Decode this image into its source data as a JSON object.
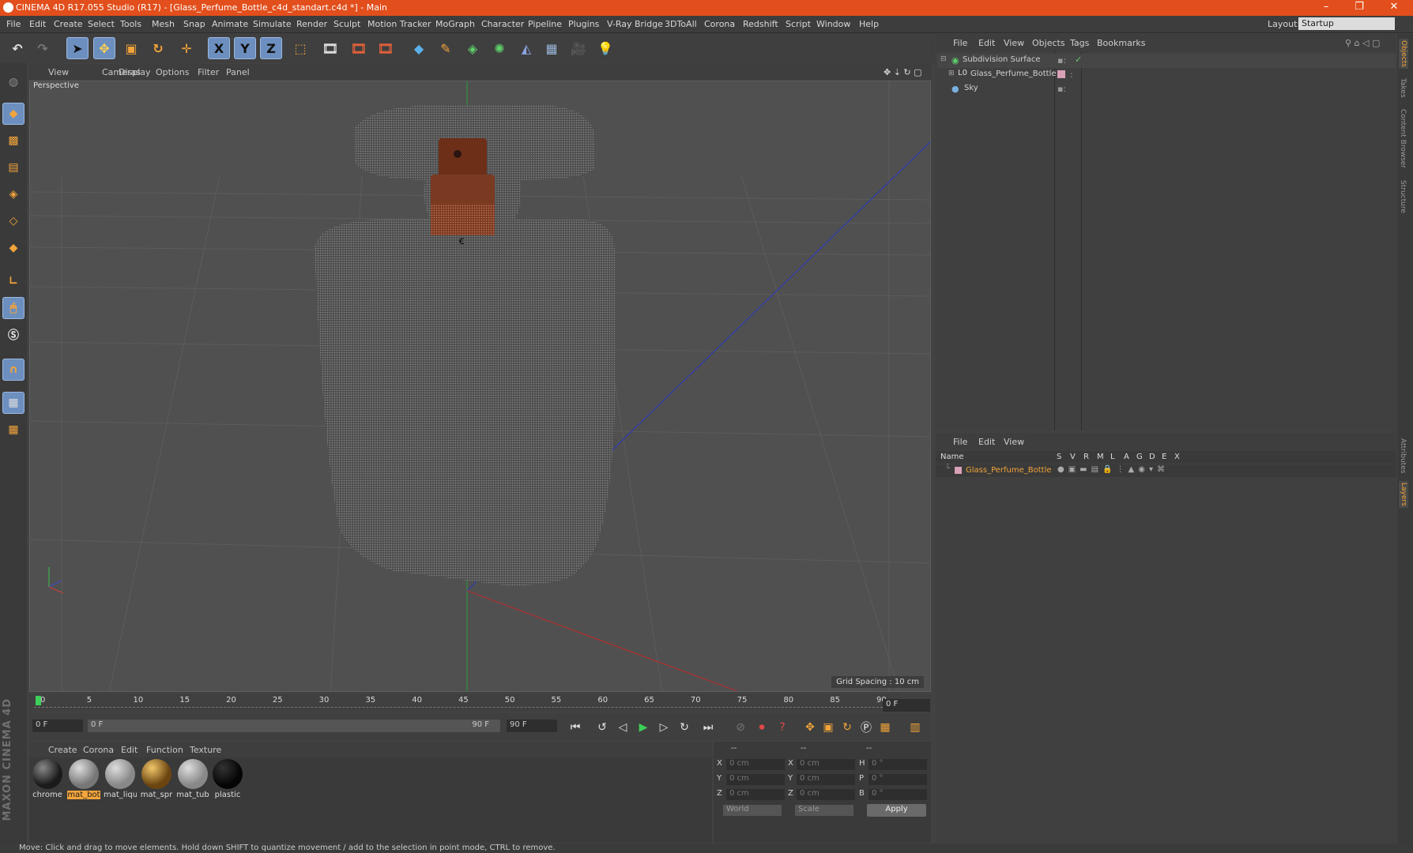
{
  "window": {
    "title": "CINEMA 4D R17.055 Studio (R17) - [Glass_Perfume_Bottle_c4d_standart.c4d *] - Main",
    "controls": {
      "minimize": "–",
      "restore": "❐",
      "close": "✕"
    }
  },
  "menubar": {
    "items": [
      "File",
      "Edit",
      "Create",
      "Select",
      "Tools",
      "Mesh",
      "Snap",
      "Animate",
      "Simulate",
      "Render",
      "Sculpt",
      "Motion Tracker",
      "MoGraph",
      "Character",
      "Pipeline",
      "Plugins",
      "V-Ray Bridge",
      "3DToAll",
      "Corona",
      "Redshift",
      "Script",
      "Window",
      "Help"
    ],
    "layout_label": "Layout:",
    "layout_value": "Startup"
  },
  "toolbar": {
    "icons": [
      "undo-icon",
      "redo-icon",
      "select-arrow-icon",
      "move-icon",
      "scale-icon",
      "rotate-icon",
      "move-all-icon",
      "axis-x-icon",
      "axis-y-icon",
      "axis-z-icon",
      "world-coord-icon",
      "render-view-icon",
      "render-picture-viewer-icon",
      "render-settings-icon",
      "cube-primitive-icon",
      "pen-spline-icon",
      "subdivision-icon",
      "cloner-icon",
      "deformer-icon",
      "floor-icon",
      "camera-icon",
      "light-icon"
    ],
    "axis_x": "X",
    "axis_y": "Y",
    "axis_z": "Z"
  },
  "viewport": {
    "menu": [
      "View",
      "Cameras",
      "Display",
      "Options",
      "Filter",
      "Panel"
    ],
    "label": "Perspective",
    "grid_spacing": "Grid Spacing : 10 cm"
  },
  "timeline": {
    "ticks": [
      "0",
      "5",
      "10",
      "15",
      "20",
      "25",
      "30",
      "35",
      "40",
      "45",
      "50",
      "55",
      "60",
      "65",
      "70",
      "75",
      "80",
      "85",
      "90"
    ],
    "current_frame_field": "0 F",
    "start_field": "0 F",
    "range_start": "0 F",
    "range_end": "90 F",
    "end_field": "90 F"
  },
  "materials": {
    "menu": [
      "Create",
      "Corona",
      "Edit",
      "Function",
      "Texture"
    ],
    "items": [
      {
        "name": "chrome",
        "color": "#1a1a1a"
      },
      {
        "name": "mat_bot",
        "color": "#8a8a8a",
        "selected": true
      },
      {
        "name": "mat_liqu",
        "color": "#9a9a9a"
      },
      {
        "name": "mat_spr",
        "color": "#8a5a1a"
      },
      {
        "name": "mat_tub",
        "color": "#9a9a9a"
      },
      {
        "name": "plastic",
        "color": "#0d0d0d"
      }
    ]
  },
  "coordinates": {
    "headers": [
      "--",
      "--",
      "--"
    ],
    "rows": [
      {
        "a": "X",
        "av": "0 cm",
        "b": "X",
        "bv": "0 cm",
        "c": "H",
        "cv": "0 °"
      },
      {
        "a": "Y",
        "av": "0 cm",
        "b": "Y",
        "bv": "0 cm",
        "c": "P",
        "cv": "0 °"
      },
      {
        "a": "Z",
        "av": "0 cm",
        "b": "Z",
        "bv": "0 cm",
        "c": "B",
        "cv": "0 °"
      }
    ],
    "mode1": "World",
    "mode2": "Scale",
    "apply": "Apply"
  },
  "object_manager": {
    "menu": [
      "File",
      "Edit",
      "View",
      "Objects",
      "Tags",
      "Bookmarks"
    ],
    "objects": [
      {
        "name": "Subdivision Surface",
        "icon": "subdivision-icon"
      },
      {
        "name": "Glass_Perfume_Bottle",
        "icon": "null-object-icon"
      },
      {
        "name": "Sky",
        "icon": "sky-icon"
      }
    ]
  },
  "layer_manager": {
    "menu": [
      "File",
      "Edit",
      "View"
    ],
    "columns": [
      "Name",
      "S",
      "V",
      "R",
      "M",
      "L",
      "A",
      "G",
      "D",
      "E",
      "X"
    ],
    "layers": [
      {
        "name": "Glass_Perfume_Bottle",
        "color": "#d9a0b8"
      }
    ]
  },
  "right_tabs": [
    "Objects",
    "Takes",
    "Content Browser",
    "Structure",
    "Attributes",
    "Layers"
  ],
  "status": "Move: Click and drag to move elements. Hold down SHIFT to quantize movement / add to the selection in point mode, CTRL to remove.",
  "brand": "MAXON CINEMA 4D",
  "colors": {
    "accent": "#e24f1c",
    "selection": "#f3a43a",
    "highlight": "#6c8fbf"
  }
}
